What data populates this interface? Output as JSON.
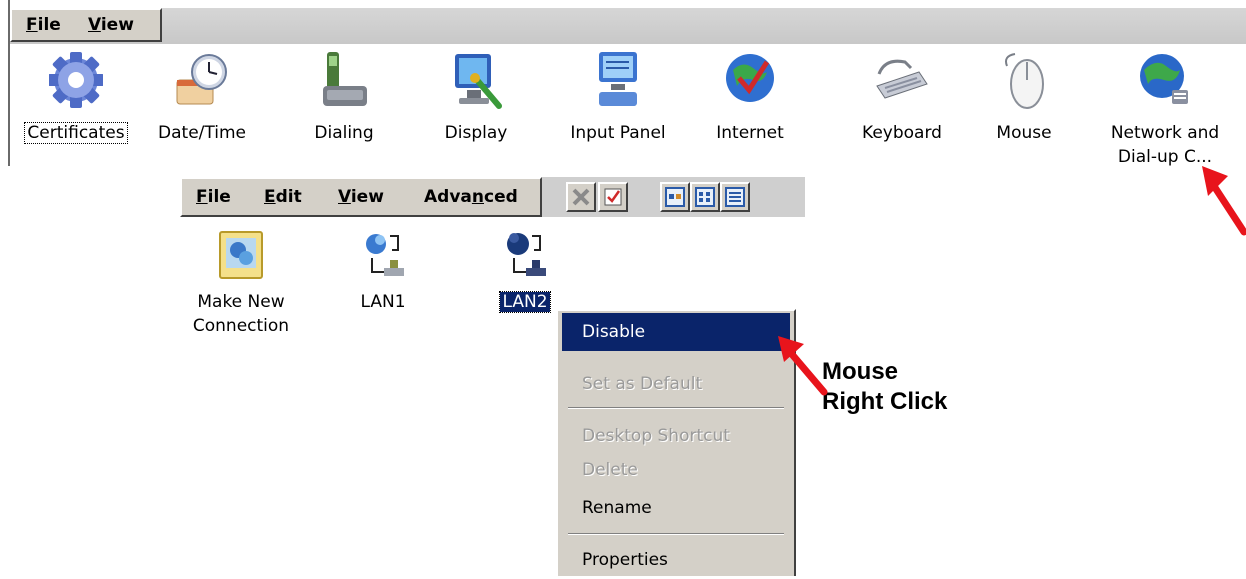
{
  "control_panel": {
    "menu": [
      {
        "mnemonic": "F",
        "rest": "ile"
      },
      {
        "mnemonic": "V",
        "rest": "iew"
      }
    ],
    "items": [
      {
        "label": "Certificates",
        "icon": "gear-icon"
      },
      {
        "label": "Date/Time",
        "icon": "clock-icon"
      },
      {
        "label": "Dialing",
        "icon": "phone-icon"
      },
      {
        "label": "Display",
        "icon": "display-icon"
      },
      {
        "label": "Input Panel",
        "icon": "input-panel-icon"
      },
      {
        "label": "Internet",
        "icon": "globe-check-icon"
      },
      {
        "label": "Keyboard",
        "icon": "keyboard-icon"
      },
      {
        "label": "Mouse",
        "icon": "mouse-icon"
      },
      {
        "label": "Network and",
        "label2": "Dial-up C...",
        "icon": "network-globe-icon"
      }
    ]
  },
  "network_window": {
    "menu": [
      {
        "mnemonic": "F",
        "rest": "ile",
        "pre": ""
      },
      {
        "mnemonic": "E",
        "rest": "dit",
        "pre": ""
      },
      {
        "mnemonic": "V",
        "rest": "iew",
        "pre": ""
      },
      {
        "pre": "Adva",
        "mnemonic": "n",
        "rest": "ced"
      }
    ],
    "toolbar": [
      "delete-icon",
      "properties-icon",
      "large-icons-view-icon",
      "small-icons-view-icon",
      "details-view-icon"
    ],
    "items": [
      {
        "label": "Make New",
        "label2": "Connection",
        "icon": "new-connection-icon"
      },
      {
        "label": "LAN1",
        "icon": "lan-icon"
      },
      {
        "label": "LAN2",
        "icon": "lan-disabled-icon"
      }
    ]
  },
  "context_menu": {
    "items": [
      "Disable",
      "Set as Default",
      "Desktop Shortcut",
      "Delete",
      "Rename",
      "Properties"
    ]
  },
  "annotation": {
    "line1": "Mouse",
    "line2": "Right Click"
  },
  "colors": {
    "highlight": "#0a246a",
    "arrow": "#e8141c",
    "menu_face": "#d4d0c8"
  }
}
